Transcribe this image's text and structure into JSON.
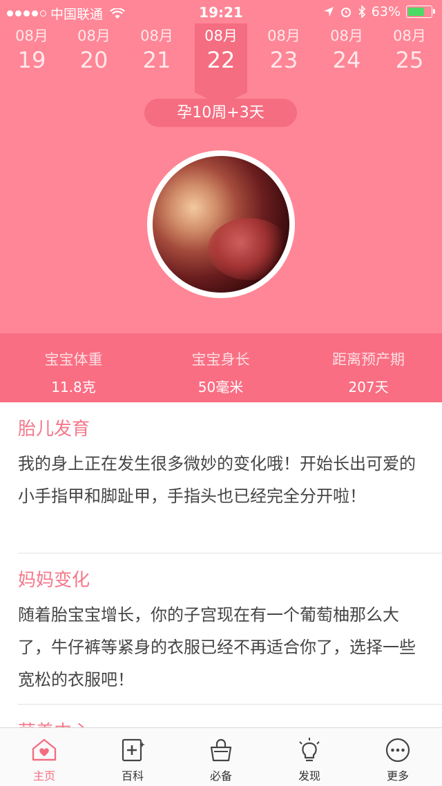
{
  "status_bar": {
    "carrier": "中国联通",
    "time": "19:21",
    "battery": "63%"
  },
  "date_strip": [
    {
      "month": "08月",
      "day": "19"
    },
    {
      "month": "08月",
      "day": "20"
    },
    {
      "month": "08月",
      "day": "21"
    },
    {
      "month": "08月",
      "day": "22"
    },
    {
      "month": "08月",
      "day": "23"
    },
    {
      "month": "08月",
      "day": "24"
    },
    {
      "month": "08月",
      "day": "25"
    }
  ],
  "week_label": "孕10周+3天",
  "stats": [
    {
      "label": "宝宝体重",
      "value": "11.8克"
    },
    {
      "label": "宝宝身长",
      "value": "50毫米"
    },
    {
      "label": "距离预产期",
      "value": "207天"
    }
  ],
  "sections": [
    {
      "title": "胎儿发育",
      "body": "我的身上正在发生很多微妙的变化哦！开始长出可爱的小手指甲和脚趾甲，手指头也已经完全分开啦！"
    },
    {
      "title": "妈妈变化",
      "body": "随着胎宝宝增长，你的子宫现在有一个葡萄柚那么大了，牛仔裤等紧身的衣服已经不再适合你了，选择一些宽松的衣服吧！"
    },
    {
      "title": "营养中心"
    }
  ],
  "tabs": [
    {
      "label": "主页",
      "icon": "home-heart-icon"
    },
    {
      "label": "百科",
      "icon": "encyclopedia-icon"
    },
    {
      "label": "必备",
      "icon": "shopping-bag-icon"
    },
    {
      "label": "发现",
      "icon": "lightbulb-icon"
    },
    {
      "label": "更多",
      "icon": "more-icon"
    }
  ],
  "colors": {
    "accent": "#f46d80",
    "hero": "#ff8696",
    "stats_band": "#f96e83"
  }
}
